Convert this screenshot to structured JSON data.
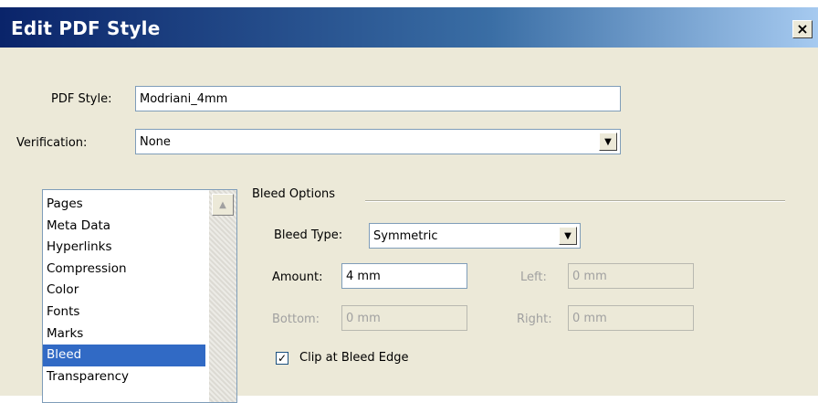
{
  "window": {
    "title": "Edit PDF Style",
    "close_glyph": "×"
  },
  "pdf_style": {
    "label": "PDF Style:",
    "value": "Modriani_4mm"
  },
  "verification": {
    "label": "Verification:",
    "value": "None"
  },
  "categories": {
    "items": [
      "Pages",
      "Meta Data",
      "Hyperlinks",
      "Compression",
      "Color",
      "Fonts",
      "Marks",
      "Bleed",
      "Transparency"
    ],
    "selected": "Bleed"
  },
  "bleed_options": {
    "group_label": "Bleed Options",
    "type_label": "Bleed Type:",
    "type_value": "Symmetric",
    "amount_label": "Amount:",
    "amount_value": "4 mm",
    "left_label": "Left:",
    "left_value": "0 mm",
    "bottom_label": "Bottom:",
    "bottom_value": "0 mm",
    "right_label": "Right:",
    "right_value": "0 mm",
    "clip_label": "Clip at Bleed Edge",
    "clip_checked": true
  },
  "colors": {
    "title_bar": "#0a246a",
    "selection": "#316ac5",
    "dialog_bg": "#ece9d8"
  }
}
